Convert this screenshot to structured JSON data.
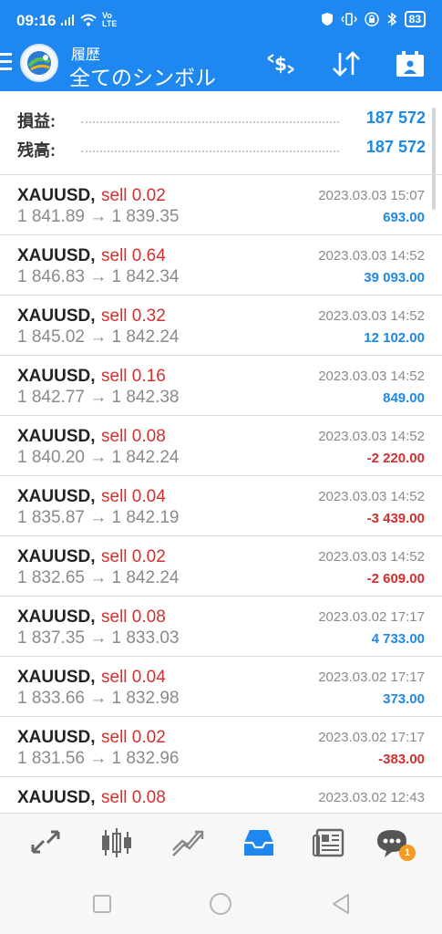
{
  "status_bar": {
    "time": "09:16",
    "network_label": "Vo LTE",
    "battery": "83",
    "icons": [
      "signal-icon",
      "wifi-icon",
      "shield-icon",
      "vibrate-icon",
      "lock-icon",
      "bluetooth-icon",
      "battery-icon"
    ]
  },
  "app_bar": {
    "subtitle": "履歴",
    "title": "全てのシンボル",
    "actions": [
      "currency-exchange-icon",
      "sort-icon",
      "calendar-icon"
    ]
  },
  "summary": {
    "profit_label": "損益:",
    "profit_value": "187 572",
    "balance_label": "残高:",
    "balance_value": "187 572"
  },
  "deals": [
    {
      "symbol": "XAUUSD,",
      "type": "sell 0.02",
      "prices": "1 841.89 → 1 839.35",
      "time": "2023.03.03 15:07",
      "profit": "693.00",
      "sign": "pos"
    },
    {
      "symbol": "XAUUSD,",
      "type": "sell 0.64",
      "prices": "1 846.83 → 1 842.34",
      "time": "2023.03.03 14:52",
      "profit": "39 093.00",
      "sign": "pos"
    },
    {
      "symbol": "XAUUSD,",
      "type": "sell 0.32",
      "prices": "1 845.02 → 1 842.24",
      "time": "2023.03.03 14:52",
      "profit": "12 102.00",
      "sign": "pos"
    },
    {
      "symbol": "XAUUSD,",
      "type": "sell 0.16",
      "prices": "1 842.77 → 1 842.38",
      "time": "2023.03.03 14:52",
      "profit": "849.00",
      "sign": "pos"
    },
    {
      "symbol": "XAUUSD,",
      "type": "sell 0.08",
      "prices": "1 840.20 → 1 842.24",
      "time": "2023.03.03 14:52",
      "profit": "-2 220.00",
      "sign": "neg"
    },
    {
      "symbol": "XAUUSD,",
      "type": "sell 0.04",
      "prices": "1 835.87 → 1 842.19",
      "time": "2023.03.03 14:52",
      "profit": "-3 439.00",
      "sign": "neg"
    },
    {
      "symbol": "XAUUSD,",
      "type": "sell 0.02",
      "prices": "1 832.65 → 1 842.24",
      "time": "2023.03.03 14:52",
      "profit": "-2 609.00",
      "sign": "neg"
    },
    {
      "symbol": "XAUUSD,",
      "type": "sell 0.08",
      "prices": "1 837.35 → 1 833.03",
      "time": "2023.03.02 17:17",
      "profit": "4 733.00",
      "sign": "pos"
    },
    {
      "symbol": "XAUUSD,",
      "type": "sell 0.04",
      "prices": "1 833.66 → 1 832.98",
      "time": "2023.03.02 17:17",
      "profit": "373.00",
      "sign": "pos"
    },
    {
      "symbol": "XAUUSD,",
      "type": "sell 0.02",
      "prices": "1 831.56 → 1 832.96",
      "time": "2023.03.02 17:17",
      "profit": "-383.00",
      "sign": "neg"
    },
    {
      "symbol": "XAUUSD,",
      "type": "sell 0.08",
      "prices": "",
      "time": "2023.03.02 12:43",
      "profit": "",
      "sign": "pos"
    }
  ],
  "bottom_nav": {
    "items": [
      "quotes-icon",
      "chart-icon",
      "trade-icon",
      "history-icon",
      "news-icon",
      "messages-icon"
    ],
    "active": "history-icon",
    "messages_badge": "1"
  },
  "colors": {
    "accent": "#1e88f0",
    "profit_positive": "#1e88e5",
    "profit_negative": "#d32f2f",
    "sell": "#d32f2f",
    "muted": "#8a8a8a"
  }
}
